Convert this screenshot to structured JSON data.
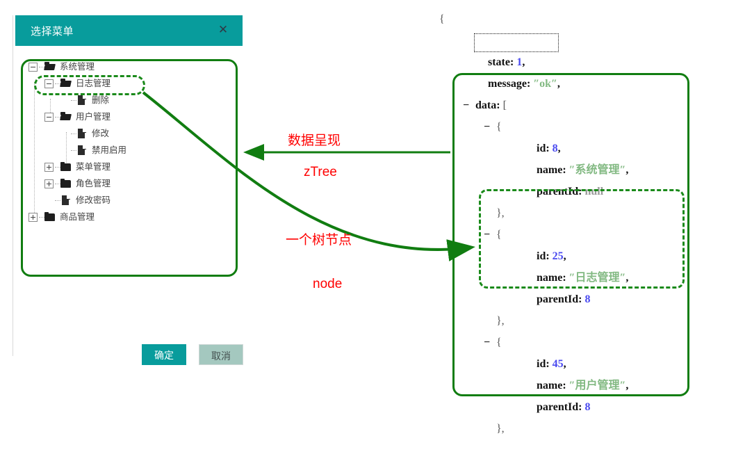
{
  "dialog": {
    "title": "选择菜单",
    "close_icon": "close-icon",
    "buttons": {
      "ok": "确定",
      "cancel": "取消"
    },
    "tree": [
      {
        "label": "系统管理",
        "level": 0,
        "switch": "minus",
        "icon": "folder-open-icon"
      },
      {
        "label": "日志管理",
        "level": 1,
        "switch": "minus",
        "icon": "folder-open-icon",
        "highlighted": true
      },
      {
        "label": "删除",
        "level": 2,
        "switch": "none",
        "icon": "doc-icon"
      },
      {
        "label": "用户管理",
        "level": 1,
        "switch": "minus",
        "icon": "folder-open-icon"
      },
      {
        "label": "修改",
        "level": 2,
        "switch": "none",
        "icon": "doc-icon"
      },
      {
        "label": "禁用启用",
        "level": 2,
        "switch": "none",
        "icon": "doc-icon"
      },
      {
        "label": "菜单管理",
        "level": 1,
        "switch": "plus",
        "icon": "folder-icon"
      },
      {
        "label": "角色管理",
        "level": 1,
        "switch": "plus",
        "icon": "folder-icon"
      },
      {
        "label": "修改密码",
        "level": 1,
        "switch": "none",
        "icon": "doc-icon"
      },
      {
        "label": "商品管理",
        "level": 0,
        "switch": "plus",
        "icon": "folder-icon"
      }
    ]
  },
  "json_panel": {
    "open_brace": "{",
    "state_key": "state:",
    "state_value": "1",
    "state_comma": ",",
    "message_key": "message:",
    "message_value": "″ok″",
    "message_comma": ",",
    "data_key": "data:",
    "data_open": "[",
    "collapse_marker": "−",
    "items": [
      {
        "open": "{",
        "id_key": "id:",
        "id_value": "8",
        "id_comma": ",",
        "name_key": "name:",
        "name_value": "″系统管理″",
        "name_comma": ",",
        "parent_key": "parentId:",
        "parent_value": "null",
        "close": "},"
      },
      {
        "open": "{",
        "id_key": "id:",
        "id_value": "25",
        "id_comma": ",",
        "name_key": "name:",
        "name_value": "″日志管理″",
        "name_comma": ",",
        "parent_key": "parentId:",
        "parent_value": "8",
        "close": "},",
        "highlighted": true
      },
      {
        "open": "{",
        "id_key": "id:",
        "id_value": "45",
        "id_comma": ",",
        "name_key": "name:",
        "name_value": "″用户管理″",
        "name_comma": ",",
        "parent_key": "parentId:",
        "parent_value": "8",
        "close": "},"
      }
    ]
  },
  "annotations": {
    "data_presentation_cn": "数据呈现",
    "data_presentation_en": "zTree",
    "tree_node_cn": "一个树节点",
    "tree_node_en": "node"
  },
  "colors": {
    "header_teal": "#089c9c",
    "annotation_red": "#ff0000",
    "highlight_green": "#117d11",
    "json_number_blue": "#4a4af0",
    "json_string_green": "#82b982"
  }
}
